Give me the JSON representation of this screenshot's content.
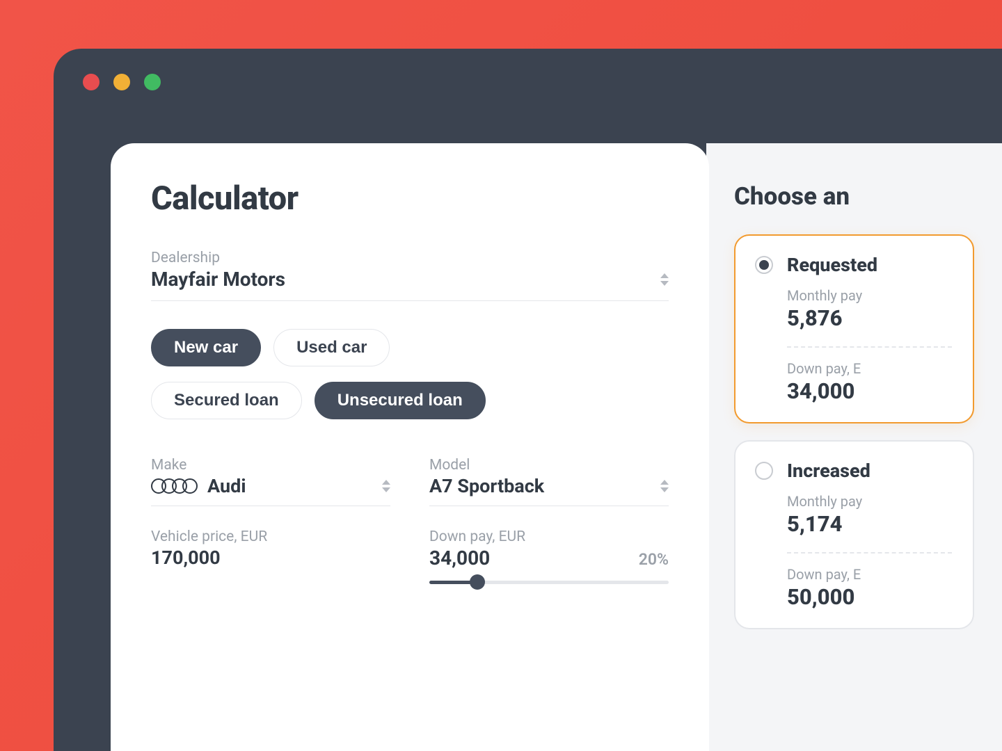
{
  "calculator": {
    "title": "Calculator",
    "dealership": {
      "label": "Dealership",
      "value": "Mayfair Motors"
    },
    "car_type": {
      "new": "New car",
      "used": "Used car"
    },
    "loan_type": {
      "secured": "Secured loan",
      "unsecured": "Unsecured loan"
    },
    "make": {
      "label": "Make",
      "value": "Audi"
    },
    "model": {
      "label": "Model",
      "value": "A7 Sportback"
    },
    "vehicle_price": {
      "label": "Vehicle price, EUR",
      "value": "170,000"
    },
    "down_pay": {
      "label": "Down pay, EUR",
      "value": "34,000",
      "pct": "20%"
    }
  },
  "side": {
    "title": "Choose an",
    "options": [
      {
        "title": "Requested",
        "monthly_label": "Monthly pay",
        "monthly_value": "5,876",
        "downpay_label": "Down pay, E",
        "downpay_value": "34,000",
        "selected": true
      },
      {
        "title": "Increased",
        "monthly_label": "Monthly pay",
        "monthly_value": "5,174",
        "downpay_label": "Down pay, E",
        "downpay_value": "50,000",
        "selected": false
      }
    ]
  }
}
